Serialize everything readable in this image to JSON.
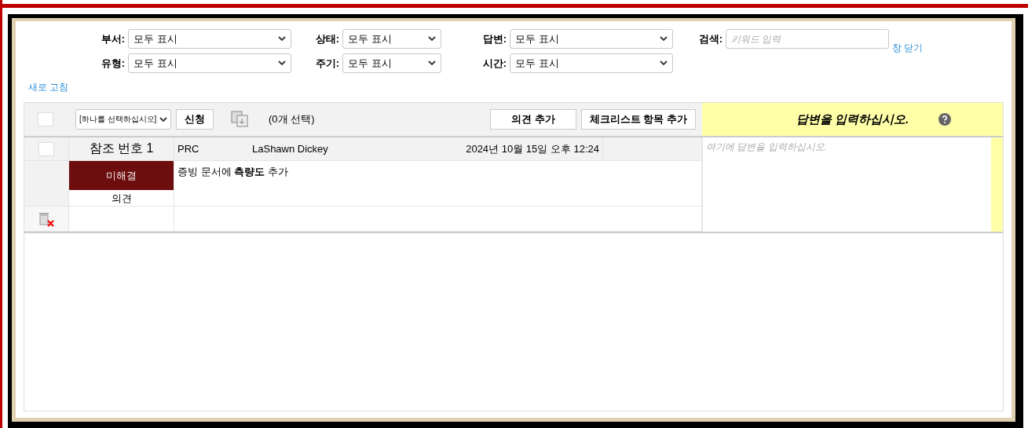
{
  "filters": [
    {
      "label": "부서:",
      "value": "모두 표시"
    },
    {
      "label": "상태:",
      "value": "모두 표시"
    },
    {
      "label": "답변:",
      "value": "모두 표시"
    },
    {
      "label": "유형:",
      "value": "모두 표시"
    },
    {
      "label": "주기:",
      "value": "모두 표시"
    },
    {
      "label": "시간:",
      "value": "모두 표시"
    }
  ],
  "search": {
    "label": "검색:",
    "placeholder": "키워드 입력"
  },
  "close_link": "창 닫기",
  "refresh_link": "새로 고침",
  "toolbar": {
    "select_all_checked": false,
    "action_select": "[하나를 선택하십시오]",
    "apply_button": "신청",
    "selection_count": "(0개 선택)",
    "buttons": [
      "의견 추가",
      "체크리스트 항목 추가"
    ]
  },
  "answer_panel": {
    "title": "답변을 입력하십시오.",
    "placeholder": "여기에 답변을 입력하십시오."
  },
  "items": [
    {
      "checked": false,
      "reference": "참조 번호 1",
      "department": "PRC",
      "person": "LaShawn Dickey",
      "date": "2024년 10월 15일 오후 12:24",
      "status": "미해결",
      "type": "의견",
      "text": "증빙 문서에 **측량도** 추가"
    }
  ]
}
